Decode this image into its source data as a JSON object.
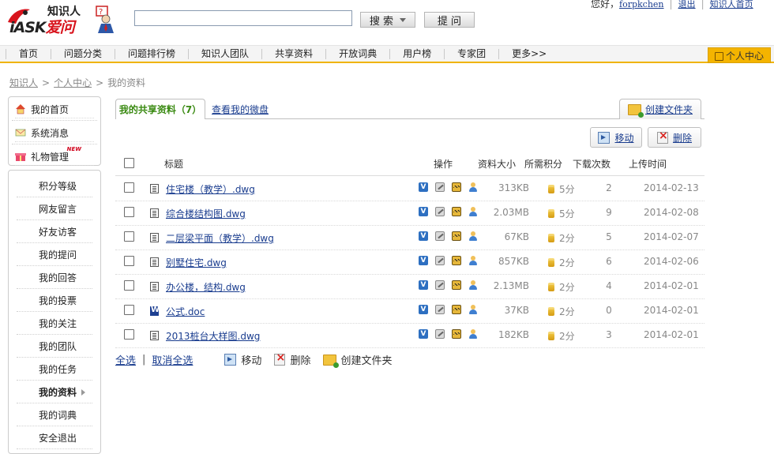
{
  "header": {
    "logo_top": "知识人",
    "logo_brand_a": "iASK",
    "logo_brand_b": "爱问",
    "search_value": "",
    "search_label": "搜 索",
    "ask_label": "提 问",
    "greeting": "您好，",
    "username": "forpkchen",
    "logout": "退出",
    "home_link": "知识人首页"
  },
  "nav": {
    "items": [
      "首页",
      "问题分类",
      "问题排行榜",
      "知识人团队",
      "共享资料",
      "开放词典",
      "用户榜",
      "专家团",
      "更多>>"
    ],
    "user_center": "个人中心"
  },
  "breadcrumb": [
    "知识人",
    "个人中心",
    "我的资料"
  ],
  "sidebar": {
    "top": [
      {
        "label": "我的首页",
        "icon": "home-icon"
      },
      {
        "label": "系统消息",
        "icon": "message-icon"
      },
      {
        "label": "礼物管理",
        "icon": "gift-icon",
        "badge": "NEW"
      }
    ],
    "items": [
      "积分等级",
      "网友留言",
      "好友访客",
      "我的提问",
      "我的回答",
      "我的投票",
      "我的关注",
      "我的团队",
      "我的任务",
      "我的资料",
      "我的词典",
      "安全退出"
    ],
    "active": "我的资料"
  },
  "tabs": {
    "shared": "我的共享资料（7）",
    "disk": "查看我的微盘",
    "create_folder": "创建文件夹"
  },
  "toolbar": {
    "move": "移动",
    "delete": "删除"
  },
  "table": {
    "headers": {
      "title": "标题",
      "ops": "操作",
      "size": "资料大小",
      "points": "所需积分",
      "downloads": "下载次数",
      "upload_time": "上传时间"
    },
    "rows": [
      {
        "title": "住宅楼（教学）.dwg",
        "type": "dwg",
        "size": "313KB",
        "points": "5分",
        "downloads": "2",
        "date": "2014-02-13"
      },
      {
        "title": "综合楼结构图.dwg",
        "type": "dwg",
        "size": "2.03MB",
        "points": "5分",
        "downloads": "9",
        "date": "2014-02-08"
      },
      {
        "title": "二层梁平面（教学）.dwg",
        "type": "dwg",
        "size": "67KB",
        "points": "2分",
        "downloads": "5",
        "date": "2014-02-07"
      },
      {
        "title": "别墅住宅.dwg",
        "type": "dwg",
        "size": "857KB",
        "points": "2分",
        "downloads": "6",
        "date": "2014-02-06"
      },
      {
        "title": "办公楼，结构.dwg",
        "type": "dwg",
        "size": "2.13MB",
        "points": "2分",
        "downloads": "4",
        "date": "2014-02-01"
      },
      {
        "title": "公式.doc",
        "type": "doc",
        "size": "37KB",
        "points": "2分",
        "downloads": "0",
        "date": "2014-02-01"
      },
      {
        "title": "2013桩台大样图.dwg",
        "type": "dwg",
        "size": "182KB",
        "points": "2分",
        "downloads": "3",
        "date": "2014-02-01"
      }
    ]
  },
  "footer": {
    "select_all": "全选",
    "deselect_all": "取消全选",
    "move": "移动",
    "delete": "删除",
    "create_folder": "创建文件夹"
  },
  "colors": {
    "accent": "#f0b400",
    "link": "#1a3d8f",
    "tab_active": "#3a8a12"
  }
}
